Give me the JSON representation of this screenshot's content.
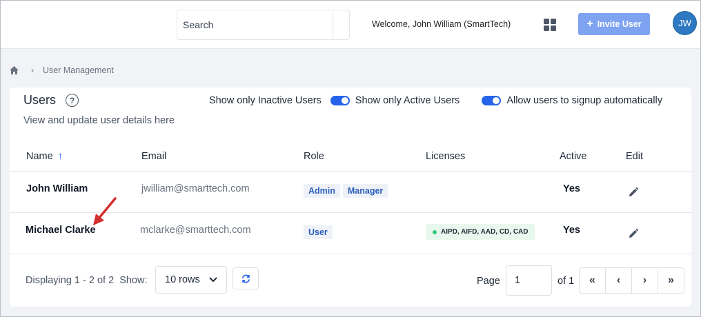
{
  "header": {
    "search_placeholder": "Search",
    "welcome": "Welcome, John William",
    "company": "(SmartTech)",
    "apps_icon": "grid-icon",
    "invite_plus": "+",
    "invite_label": "Invite User",
    "avatar_initials": "JW"
  },
  "breadcrumb": {
    "home_icon": "home-icon",
    "separator": "›",
    "current": "User Management"
  },
  "card": {
    "title": "Users",
    "help_glyph": "?",
    "subtitle": "View and update user details here",
    "filters": [
      {
        "label": "Show only Inactive Users"
      },
      {
        "label": "Show only Active Users",
        "toggle_on": true
      },
      {
        "label": "Allow users to signup automatically",
        "toggle_on": true
      }
    ]
  },
  "table": {
    "columns": [
      "Name",
      "Email",
      "Role",
      "Licenses",
      "Active",
      "Edit"
    ],
    "sort_glyph": "↑",
    "rows": [
      {
        "name": "John William",
        "email": "jwilliam@smarttech.com",
        "roles": [
          "Admin",
          "Manager"
        ],
        "licenses": "",
        "active": "Yes"
      },
      {
        "name": "Michael Clarke",
        "email": "mclarke@smarttech.com",
        "roles": [
          "User"
        ],
        "licenses": "AIPD, AIFD, AAD, CD, CAD",
        "active": "Yes"
      }
    ]
  },
  "footer": {
    "displaying": "Displaying 1 - 2 of 2",
    "show_label": "Show:",
    "rows_value": "10 rows",
    "page_label": "Page",
    "page_value": "1",
    "of_label": "of 1",
    "pager": [
      "«",
      "‹",
      "›",
      "»"
    ]
  },
  "colors": {
    "accent": "#2563eb",
    "invite_button": "#7ea3f1",
    "avatar": "#2e79c2",
    "license_dot": "#34c77a",
    "annotation_arrow": "#d32f2f"
  }
}
